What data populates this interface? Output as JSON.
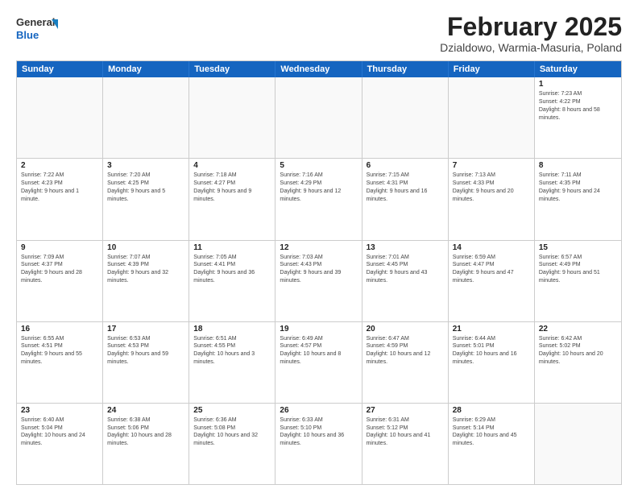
{
  "header": {
    "logo": {
      "general": "General",
      "blue": "Blue"
    },
    "title": "February 2025",
    "subtitle": "Dzialdowo, Warmia-Masuria, Poland"
  },
  "days_of_week": [
    "Sunday",
    "Monday",
    "Tuesday",
    "Wednesday",
    "Thursday",
    "Friday",
    "Saturday"
  ],
  "weeks": [
    [
      {
        "day": "",
        "info": "",
        "empty": true
      },
      {
        "day": "",
        "info": "",
        "empty": true
      },
      {
        "day": "",
        "info": "",
        "empty": true
      },
      {
        "day": "",
        "info": "",
        "empty": true
      },
      {
        "day": "",
        "info": "",
        "empty": true
      },
      {
        "day": "",
        "info": "",
        "empty": true
      },
      {
        "day": "1",
        "info": "Sunrise: 7:23 AM\nSunset: 4:22 PM\nDaylight: 8 hours and 58 minutes."
      }
    ],
    [
      {
        "day": "2",
        "info": "Sunrise: 7:22 AM\nSunset: 4:23 PM\nDaylight: 9 hours and 1 minute."
      },
      {
        "day": "3",
        "info": "Sunrise: 7:20 AM\nSunset: 4:25 PM\nDaylight: 9 hours and 5 minutes."
      },
      {
        "day": "4",
        "info": "Sunrise: 7:18 AM\nSunset: 4:27 PM\nDaylight: 9 hours and 9 minutes."
      },
      {
        "day": "5",
        "info": "Sunrise: 7:16 AM\nSunset: 4:29 PM\nDaylight: 9 hours and 12 minutes."
      },
      {
        "day": "6",
        "info": "Sunrise: 7:15 AM\nSunset: 4:31 PM\nDaylight: 9 hours and 16 minutes."
      },
      {
        "day": "7",
        "info": "Sunrise: 7:13 AM\nSunset: 4:33 PM\nDaylight: 9 hours and 20 minutes."
      },
      {
        "day": "8",
        "info": "Sunrise: 7:11 AM\nSunset: 4:35 PM\nDaylight: 9 hours and 24 minutes."
      }
    ],
    [
      {
        "day": "9",
        "info": "Sunrise: 7:09 AM\nSunset: 4:37 PM\nDaylight: 9 hours and 28 minutes."
      },
      {
        "day": "10",
        "info": "Sunrise: 7:07 AM\nSunset: 4:39 PM\nDaylight: 9 hours and 32 minutes."
      },
      {
        "day": "11",
        "info": "Sunrise: 7:05 AM\nSunset: 4:41 PM\nDaylight: 9 hours and 36 minutes."
      },
      {
        "day": "12",
        "info": "Sunrise: 7:03 AM\nSunset: 4:43 PM\nDaylight: 9 hours and 39 minutes."
      },
      {
        "day": "13",
        "info": "Sunrise: 7:01 AM\nSunset: 4:45 PM\nDaylight: 9 hours and 43 minutes."
      },
      {
        "day": "14",
        "info": "Sunrise: 6:59 AM\nSunset: 4:47 PM\nDaylight: 9 hours and 47 minutes."
      },
      {
        "day": "15",
        "info": "Sunrise: 6:57 AM\nSunset: 4:49 PM\nDaylight: 9 hours and 51 minutes."
      }
    ],
    [
      {
        "day": "16",
        "info": "Sunrise: 6:55 AM\nSunset: 4:51 PM\nDaylight: 9 hours and 55 minutes."
      },
      {
        "day": "17",
        "info": "Sunrise: 6:53 AM\nSunset: 4:53 PM\nDaylight: 9 hours and 59 minutes."
      },
      {
        "day": "18",
        "info": "Sunrise: 6:51 AM\nSunset: 4:55 PM\nDaylight: 10 hours and 3 minutes."
      },
      {
        "day": "19",
        "info": "Sunrise: 6:49 AM\nSunset: 4:57 PM\nDaylight: 10 hours and 8 minutes."
      },
      {
        "day": "20",
        "info": "Sunrise: 6:47 AM\nSunset: 4:59 PM\nDaylight: 10 hours and 12 minutes."
      },
      {
        "day": "21",
        "info": "Sunrise: 6:44 AM\nSunset: 5:01 PM\nDaylight: 10 hours and 16 minutes."
      },
      {
        "day": "22",
        "info": "Sunrise: 6:42 AM\nSunset: 5:02 PM\nDaylight: 10 hours and 20 minutes."
      }
    ],
    [
      {
        "day": "23",
        "info": "Sunrise: 6:40 AM\nSunset: 5:04 PM\nDaylight: 10 hours and 24 minutes."
      },
      {
        "day": "24",
        "info": "Sunrise: 6:38 AM\nSunset: 5:06 PM\nDaylight: 10 hours and 28 minutes."
      },
      {
        "day": "25",
        "info": "Sunrise: 6:36 AM\nSunset: 5:08 PM\nDaylight: 10 hours and 32 minutes."
      },
      {
        "day": "26",
        "info": "Sunrise: 6:33 AM\nSunset: 5:10 PM\nDaylight: 10 hours and 36 minutes."
      },
      {
        "day": "27",
        "info": "Sunrise: 6:31 AM\nSunset: 5:12 PM\nDaylight: 10 hours and 41 minutes."
      },
      {
        "day": "28",
        "info": "Sunrise: 6:29 AM\nSunset: 5:14 PM\nDaylight: 10 hours and 45 minutes."
      },
      {
        "day": "",
        "info": "",
        "empty": true
      }
    ]
  ]
}
